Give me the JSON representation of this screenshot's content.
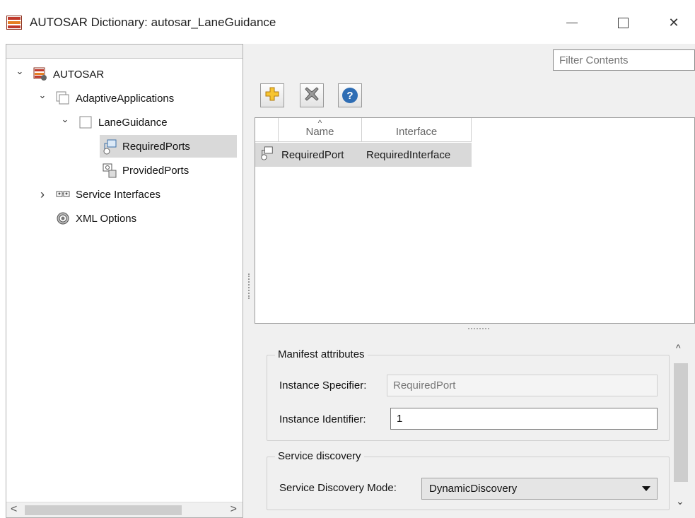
{
  "window": {
    "title": "AUTOSAR Dictionary: autosar_LaneGuidance",
    "minimize_glyph": "",
    "maximize_glyph": "",
    "close_glyph": "✕"
  },
  "tree": {
    "items": [
      {
        "label": "AUTOSAR",
        "expanded": true,
        "icon": "autosar-root-icon"
      },
      {
        "label": "AdaptiveApplications",
        "expanded": true,
        "icon": "package-icon"
      },
      {
        "label": "LaneGuidance",
        "expanded": true,
        "icon": "component-icon"
      },
      {
        "label": "RequiredPorts",
        "selected": true,
        "icon": "required-port-icon"
      },
      {
        "label": "ProvidedPorts",
        "icon": "provided-port-icon"
      },
      {
        "label": "Service Interfaces",
        "expanded": false,
        "icon": "service-interface-icon"
      },
      {
        "label": "XML Options",
        "icon": "gear-icon"
      }
    ]
  },
  "filter": {
    "placeholder": "Filter Contents"
  },
  "toolbar": {
    "add_icon": "add-icon",
    "delete_icon": "delete-icon",
    "help_icon": "help-icon",
    "help_glyph": "?"
  },
  "grid": {
    "columns": [
      "Name",
      "Interface"
    ],
    "rows": [
      {
        "name": "RequiredPort",
        "interface": "RequiredInterface"
      }
    ]
  },
  "manifest": {
    "legend": "Manifest attributes",
    "instance_specifier_label": "Instance Specifier:",
    "instance_specifier_value": "RequiredPort",
    "instance_identifier_label": "Instance Identifier:",
    "instance_identifier_value": "1"
  },
  "discovery": {
    "legend": "Service discovery",
    "mode_label": "Service Discovery Mode:",
    "mode_value": "DynamicDiscovery"
  },
  "glyphs": {
    "chevron_down": "⌄",
    "chevron_right": "›",
    "scroll_left": "<",
    "scroll_right": ">",
    "scroll_up": "^",
    "scroll_down": "⌄",
    "sort_up": "^"
  }
}
